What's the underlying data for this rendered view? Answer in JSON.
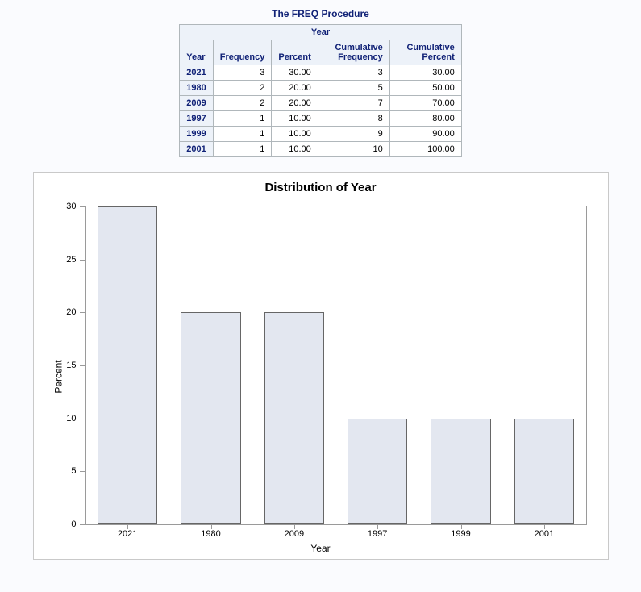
{
  "title": "The FREQ Procedure",
  "table": {
    "caption": "Year",
    "cols": [
      "Year",
      "Frequency",
      "Percent",
      "Cumulative Frequency",
      "Cumulative Percent"
    ],
    "rows": [
      {
        "year": "2021",
        "freq": "3",
        "pct": "30.00",
        "cfreq": "3",
        "cpct": "30.00"
      },
      {
        "year": "1980",
        "freq": "2",
        "pct": "20.00",
        "cfreq": "5",
        "cpct": "50.00"
      },
      {
        "year": "2009",
        "freq": "2",
        "pct": "20.00",
        "cfreq": "7",
        "cpct": "70.00"
      },
      {
        "year": "1997",
        "freq": "1",
        "pct": "10.00",
        "cfreq": "8",
        "cpct": "80.00"
      },
      {
        "year": "1999",
        "freq": "1",
        "pct": "10.00",
        "cfreq": "9",
        "cpct": "90.00"
      },
      {
        "year": "2001",
        "freq": "1",
        "pct": "10.00",
        "cfreq": "10",
        "cpct": "100.00"
      }
    ]
  },
  "chart_data": {
    "type": "bar",
    "title": "Distribution of Year",
    "xlabel": "Year",
    "ylabel": "Percent",
    "ylim": [
      0,
      30
    ],
    "yticks": [
      0,
      5,
      10,
      15,
      20,
      25,
      30
    ],
    "categories": [
      "2021",
      "1980",
      "2009",
      "1997",
      "1999",
      "2001"
    ],
    "values": [
      30,
      20,
      20,
      10,
      10,
      10
    ]
  }
}
